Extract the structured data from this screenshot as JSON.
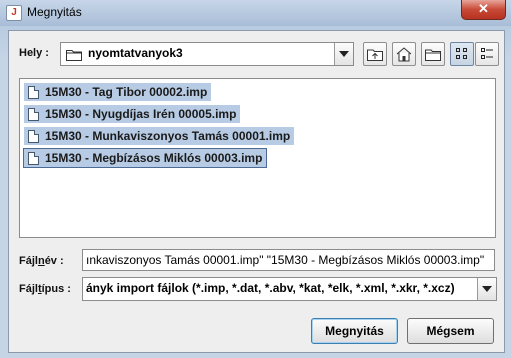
{
  "window": {
    "title": "Megnyitás",
    "close_label": "✕"
  },
  "location": {
    "label": "Hely :",
    "value": "nyomtatvanyok3"
  },
  "toolbar": {
    "buttons": [
      {
        "name": "up-one-level-button",
        "icon": "folder-up-icon"
      },
      {
        "name": "home-button",
        "icon": "home-icon"
      },
      {
        "name": "new-folder-button",
        "icon": "new-folder-icon"
      },
      {
        "name": "list-view-button",
        "icon": "list-view-icon",
        "pressed": true
      },
      {
        "name": "details-view-button",
        "icon": "details-view-icon"
      }
    ]
  },
  "files": [
    {
      "label": "15M30 - Tag Tibor 00002.imp"
    },
    {
      "label": "15M30 - Nyugdíjas Irén 00005.imp"
    },
    {
      "label": "15M30 - Munkaviszonyos Tamás 00001.imp"
    },
    {
      "label": "15M30 - Megbízásos Miklós 00003.imp"
    }
  ],
  "filename": {
    "label_pre": "Fájl",
    "label_u": "n",
    "label_post": "év :",
    "value": "ınkaviszonyos Tamás 00001.imp\" \"15M30 - Megbízásos Miklós 00003.imp\""
  },
  "filetype": {
    "label_pre": "Fájl",
    "label_u": "t",
    "label_post": "ípus :",
    "value": "ányk import fájlok (*.imp, *.dat, *.abv, *kat, *elk, *.xml, *.xkr, *.xcz)"
  },
  "buttons": {
    "open": "Megnyitás",
    "cancel": "Mégsem"
  }
}
